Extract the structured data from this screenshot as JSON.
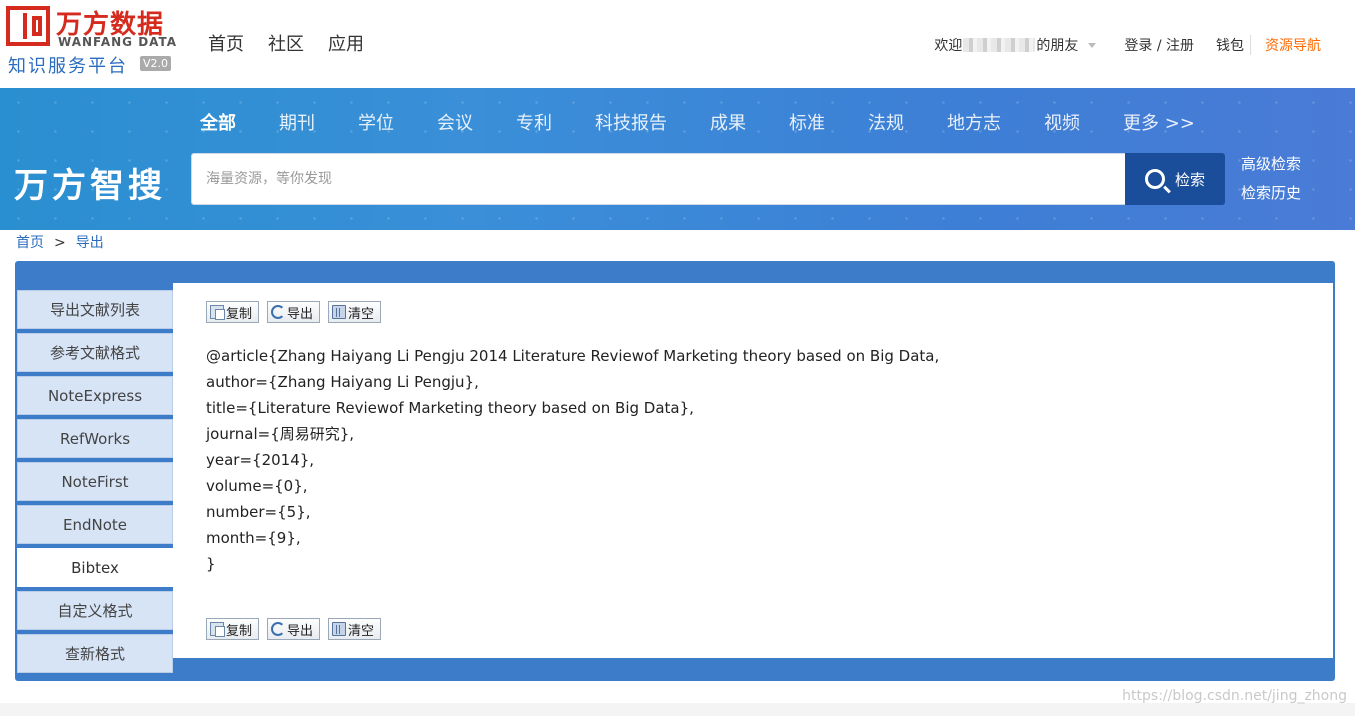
{
  "logo": {
    "cn": "万方数据",
    "en": "WANFANG DATA",
    "sub": "知识服务平台",
    "version": "V2.0"
  },
  "topnav": [
    "首页",
    "社区",
    "应用"
  ],
  "user": {
    "welcome_prefix": "欢迎",
    "welcome_suffix": "的朋友",
    "login": "登录 / 注册",
    "wallet": "钱包",
    "resource_nav": "资源导航"
  },
  "categories": [
    "全部",
    "期刊",
    "学位",
    "会议",
    "专利",
    "科技报告",
    "成果",
    "标准",
    "法规",
    "地方志",
    "视频",
    "更多 >>"
  ],
  "brand": "万方智搜",
  "search": {
    "placeholder": "海量资源，等你发现",
    "button": "检索"
  },
  "side_links": [
    "高级检索",
    "检索历史"
  ],
  "breadcrumb": [
    "首页",
    ">",
    "导出"
  ],
  "menu": [
    "导出文献列表",
    "参考文献格式",
    "NoteExpress",
    "RefWorks",
    "NoteFirst",
    "EndNote",
    "Bibtex",
    "自定义格式",
    "查新格式"
  ],
  "active_menu": "Bibtex",
  "toolbar": {
    "copy": "复制",
    "export": "导出",
    "clear": "清空"
  },
  "bibtex_lines": [
    "@article{Zhang Haiyang Li Pengju 2014 Literature Reviewof Marketing theory based on Big Data,",
    "author={Zhang Haiyang Li Pengju},",
    "title={Literature Reviewof Marketing theory based on Big Data},",
    "journal={周易研究},",
    "year={2014},",
    "volume={0},",
    "number={5},",
    "month={9},",
    "}"
  ],
  "watermark": "https://blog.csdn.net/jing_zhong",
  "colors": {
    "brand_red": "#d52b1e",
    "link_blue": "#2a6cbf",
    "panel_blue": "#3c7cc8",
    "search_button": "#1a4e9a",
    "resource_orange": "#ff6a00"
  }
}
